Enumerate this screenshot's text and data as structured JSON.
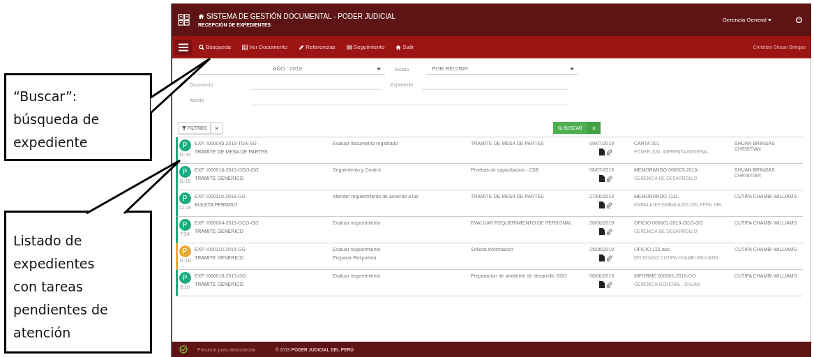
{
  "header": {
    "title": "SISTEMA DE GESTIÓN DOCUMENTAL - PODER JUDICIAL",
    "subtitle": "RECEPCIÓN DE EXPEDIENTES",
    "user_menu": "Gerencia General"
  },
  "nav": {
    "items": [
      {
        "label": "Búsqueda",
        "kind": "search"
      },
      {
        "label": "Ver Documento",
        "kind": "table"
      },
      {
        "label": "Referencias",
        "kind": "pencil"
      },
      {
        "label": "Seguimiento",
        "kind": "list"
      },
      {
        "label": "Salir",
        "kind": "home"
      }
    ],
    "user": "Christian Shuan Bringas"
  },
  "form": {
    "year": "AÑO : 2019",
    "estado_label": "Estado",
    "estado": "POR RECIBIR",
    "documento_label": "Documento",
    "expediente_label": "Expediente",
    "asunto_label": "Asunto"
  },
  "filters": {
    "filter_button": "FILTROS",
    "clear": "×",
    "search_button": "BUSCAR",
    "search_clear": "×"
  },
  "rows": [
    {
      "avatar": "P",
      "color": "#1fa97e",
      "time": "11:43",
      "expediente": "EXP. I000045-2019-TDA-SG",
      "type": "TRAMITE DE MESA DE PARTES",
      "tasks": [
        "Evaluar documento registrado"
      ],
      "description": "TRAMITE DE MESA DE PARTES",
      "date": "09/07/2019",
      "document": "CARTA 001",
      "origin": "PODER JUD. IMPRENTA GENERAL",
      "person": "SHUAN BRINGAS CHRISTIAN"
    },
    {
      "avatar": "P",
      "color": "#1fa97e",
      "time": "11:16",
      "expediente": "EXP. I000016-2019-GDO-GG",
      "type": "TRAMITE GENERICO",
      "tasks": [
        "Seguimiento y Control"
      ],
      "description": "Pruebas de capacitacion - CSB",
      "date": "08/07/2019",
      "document": "MEMORANDO 000003-2019-",
      "origin": "GERENCIA DE DESARROLLO",
      "person": "SHUAN BRINGAS CHRISTIAN"
    },
    {
      "avatar": "P",
      "color": "#1fa97e",
      "time": "12:19",
      "expediente": "EXP. I000119-2019-GG",
      "type": "BOLETA PERMISO",
      "tasks": [
        "Atender requerimiento de acuerdo a los"
      ],
      "description": "TRAMITE DE MESA DE PARTES",
      "date": "27/06/2019",
      "document": "MEMORANDO 1111",
      "origin": "EMBALAJES EMBALAJES DEL PERU SRL",
      "person": "CUTIPA CHAMBI WILLIAMS"
    },
    {
      "avatar": "P",
      "color": "#1fa97e",
      "time": "7:54",
      "expediente": "EXP. I000004-2019-GCO-GG",
      "type": "TRAMITE GENERICO",
      "tasks": [
        "Evaluar requerimiento"
      ],
      "description": "EVALUAR REQUERIMIENTO DE PERSONAL",
      "date": "26/06/2019",
      "document": "OFICIO 000001-2019-GCO-GG",
      "origin": "GERENCIA DE DESARROLLO",
      "person": "CUTIPA CHAMBI WILLIAMS"
    },
    {
      "avatar": "P",
      "color": "#e8a93a",
      "time": "11:18",
      "expediente": "EXP. I000110-2019-GG",
      "type": "TRAMITE GENERICO",
      "tasks": [
        "Evaluar requerimiento",
        "Preparar Respuesta"
      ],
      "description": "Solicita información",
      "date": "25/06/2019",
      "document": "OFICIO 123-abc",
      "origin": "DELEGADO CUTIPA CHAMBI WILLIAMS",
      "person": "CUTIPA CHAMBI WILLIAMS"
    },
    {
      "avatar": "P",
      "color": "#1fa97e",
      "time": "8:10",
      "expediente": "EXP. I000010-2019-GG",
      "type": "TRAMITE GENERICO",
      "tasks": [
        "Evaluar requerimiento"
      ],
      "description": "Preparacion de ambiente de desarrollo SGD",
      "date": "06/06/2019",
      "document": "INFORME 000001-2019-GG",
      "origin": "GERENCIA GENERAL - SHUAN",
      "person": "CUTIPA CHAMBI WILLIAMS"
    }
  ],
  "footer": {
    "status": "Presione para desconectar",
    "copyright": "© 2019 **PODER JUDICIAL DEL PERÚ**"
  },
  "callouts": [
    {
      "text": "“Buscar”: búsqueda de expediente"
    },
    {
      "text": "Listado de expedientes con tareas pendientes de atención"
    }
  ]
}
